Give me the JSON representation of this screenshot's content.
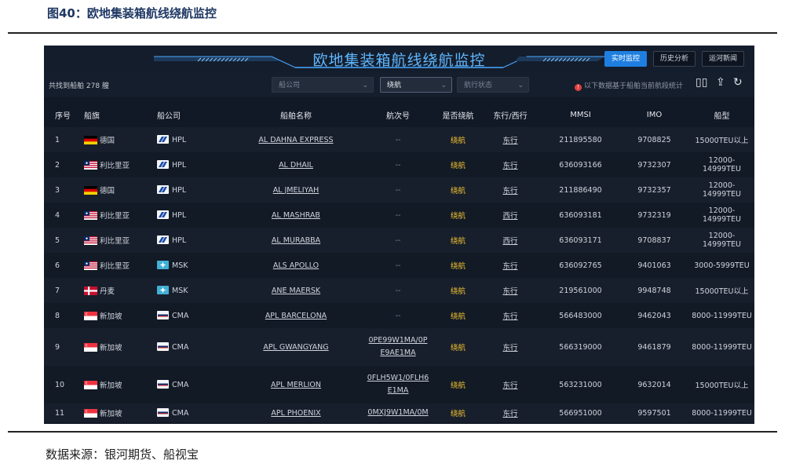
{
  "figure": {
    "title": "图40：欧地集装箱航线绕航监控",
    "source": "数据来源：银河期货、船视宝"
  },
  "header": {
    "title": "欧地集装箱航线绕航监控",
    "buttons": [
      "实时监控",
      "历史分析",
      "运河新闻"
    ]
  },
  "filters": {
    "found": "共找到船舶 278 艘",
    "company": "船公司",
    "detour": "绕航",
    "status": "航行状态",
    "notice": "以下数据基于船舶当前航段统计"
  },
  "columns": [
    "序号",
    "船旗",
    "船公司",
    "船舶名称",
    "航次号",
    "是否绕航",
    "东行/西行",
    "MMSI",
    "IMO",
    "船型"
  ],
  "rows": [
    {
      "no": "1",
      "flag": "德国",
      "flag_code": "de",
      "company": "HPL",
      "name": "AL DAHNA EXPRESS",
      "voyage": "--",
      "detour": "绕航",
      "dir": "东行",
      "mmsi": "211895580",
      "imo": "9708825",
      "type": "15000TEU以上"
    },
    {
      "no": "2",
      "flag": "利比里亚",
      "flag_code": "lr",
      "company": "HPL",
      "name": "AL DHAIL",
      "voyage": "--",
      "detour": "绕航",
      "dir": "东行",
      "mmsi": "636093166",
      "imo": "9732307",
      "type": "12000-14999TEU"
    },
    {
      "no": "3",
      "flag": "德国",
      "flag_code": "de",
      "company": "HPL",
      "name": "AL JMELIYAH",
      "voyage": "--",
      "detour": "绕航",
      "dir": "东行",
      "mmsi": "211886490",
      "imo": "9732357",
      "type": "12000-14999TEU"
    },
    {
      "no": "4",
      "flag": "利比里亚",
      "flag_code": "lr",
      "company": "HPL",
      "name": "AL MASHRAB",
      "voyage": "--",
      "detour": "绕航",
      "dir": "西行",
      "mmsi": "636093181",
      "imo": "9732319",
      "type": "12000-14999TEU"
    },
    {
      "no": "5",
      "flag": "利比里亚",
      "flag_code": "lr",
      "company": "HPL",
      "name": "AL MURABBA",
      "voyage": "--",
      "detour": "绕航",
      "dir": "西行",
      "mmsi": "636093171",
      "imo": "9708837",
      "type": "12000-14999TEU"
    },
    {
      "no": "6",
      "flag": "利比里亚",
      "flag_code": "lr",
      "company": "MSK",
      "name": "ALS APOLLO",
      "voyage": "--",
      "detour": "绕航",
      "dir": "东行",
      "mmsi": "636092765",
      "imo": "9401063",
      "type": "3000-5999TEU"
    },
    {
      "no": "7",
      "flag": "丹麦",
      "flag_code": "dk",
      "company": "MSK",
      "name": "ANE MAERSK",
      "voyage": "--",
      "detour": "绕航",
      "dir": "东行",
      "mmsi": "219561000",
      "imo": "9948748",
      "type": "15000TEU以上"
    },
    {
      "no": "8",
      "flag": "新加坡",
      "flag_code": "sg",
      "company": "CMA",
      "name": "APL BARCELONA",
      "voyage": "--",
      "detour": "绕航",
      "dir": "东行",
      "mmsi": "566483000",
      "imo": "9462043",
      "type": "8000-11999TEU"
    },
    {
      "no": "9",
      "flag": "新加坡",
      "flag_code": "sg",
      "company": "CMA",
      "name": "APL GWANGYANG",
      "voyage": "0PE99W1MA/0PE9AE1MA",
      "detour": "绕航",
      "dir": "东行",
      "mmsi": "566319000",
      "imo": "9461879",
      "type": "8000-11999TEU"
    },
    {
      "no": "10",
      "flag": "新加坡",
      "flag_code": "sg",
      "company": "CMA",
      "name": "APL MERLION",
      "voyage": "0FLH5W1/0FLH6E1MA",
      "detour": "绕航",
      "dir": "东行",
      "mmsi": "563231000",
      "imo": "9632014",
      "type": "15000TEU以上"
    },
    {
      "no": "11",
      "flag": "新加坡",
      "flag_code": "sg",
      "company": "CMA",
      "name": "APL PHOENIX",
      "voyage": "0MXJ9W1MA/0M",
      "detour": "绕航",
      "dir": "东行",
      "mmsi": "566951000",
      "imo": "9597501",
      "type": "8000-11999TEU"
    }
  ]
}
